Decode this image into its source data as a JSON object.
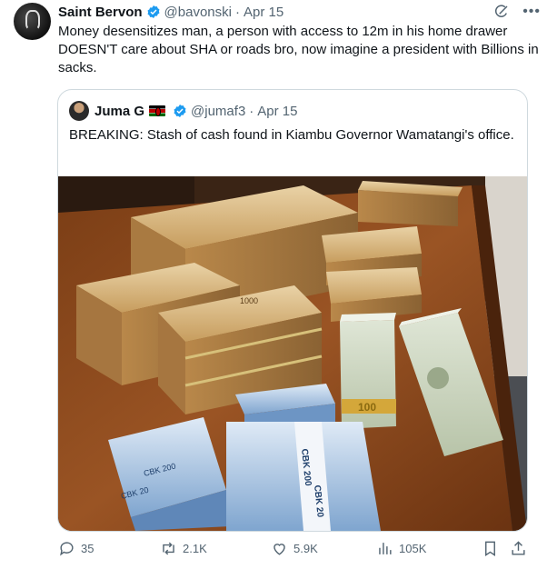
{
  "tweet": {
    "author_name": "Saint Bervon",
    "author_handle": "@bavonski",
    "separator": "·",
    "date": "Apr 15",
    "text": "Money desensitizes man, a person with access to 12m in his home drawer DOESN'T care about SHA or roads bro, now imagine a president with Billions in sacks."
  },
  "quoted_tweet": {
    "author_name": "Juma G",
    "author_handle": "@jumaf3",
    "separator": "·",
    "date": "Apr 15",
    "text": "BREAKING: Stash of cash found in Kiambu Governor Wamatangi's office.",
    "image_labels": {
      "usd_band": "100",
      "cbk_label_1": "CBK 200",
      "cbk_label_2": "CBK 20",
      "cbk_label_3": "CBK 200",
      "cbk_label_4": "CBK 20",
      "ksh_label": "1000"
    }
  },
  "actions": {
    "replies": "35",
    "reposts": "2.1K",
    "likes": "5.9K",
    "views": "105K"
  },
  "icons": {
    "verified": "verified-badge-icon",
    "grok": "grok-icon",
    "more": "more-icon",
    "reply": "reply-icon",
    "repost": "repost-icon",
    "like": "like-icon",
    "views": "views-icon",
    "bookmark": "bookmark-icon",
    "share": "share-icon"
  },
  "colors": {
    "text": "#0f1419",
    "secondary": "#536471",
    "verified": "#1d9bf0",
    "border": "#cfd9de"
  }
}
